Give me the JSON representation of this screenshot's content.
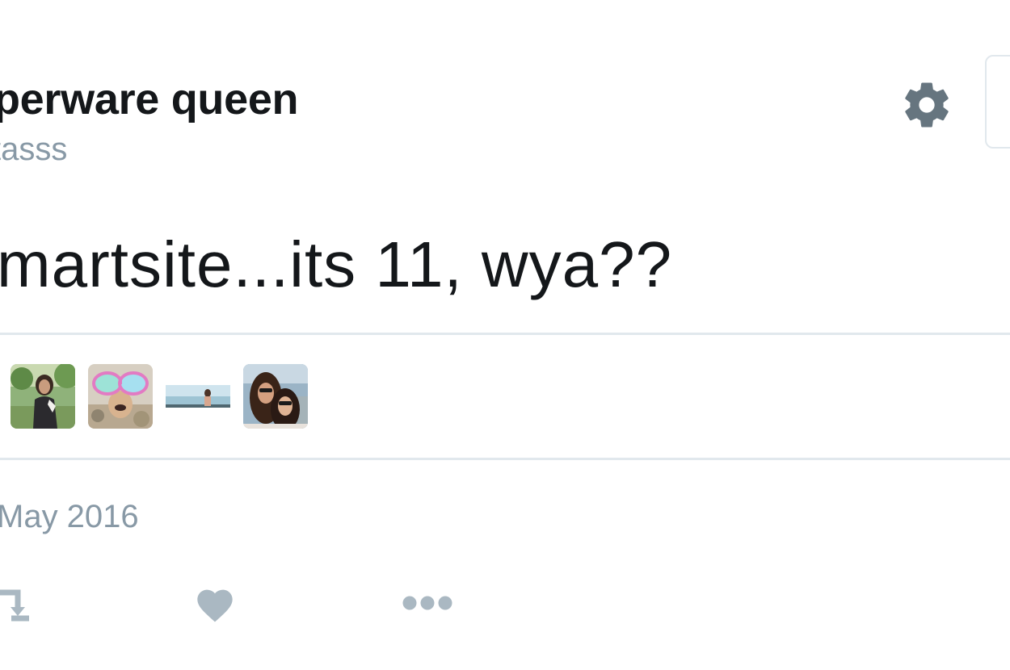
{
  "profile": {
    "display_name": "perware queen",
    "handle": "tasss"
  },
  "tweet": {
    "text": "martsite...its 11, wya??",
    "timestamp": "May 2016"
  },
  "likers": [
    {
      "name": "liker-avatar-1"
    },
    {
      "name": "liker-avatar-2"
    },
    {
      "name": "liker-avatar-3"
    },
    {
      "name": "liker-avatar-4"
    }
  ],
  "icons": {
    "settings": "gear-icon",
    "retweet": "retweet-icon",
    "like": "heart-icon",
    "more": "more-dots-icon"
  },
  "colors": {
    "text_primary": "#14171a",
    "text_secondary": "#8899a6",
    "icon_gray": "#66757f",
    "action_gray": "#aab8c2",
    "divider": "#e1e8ed"
  }
}
